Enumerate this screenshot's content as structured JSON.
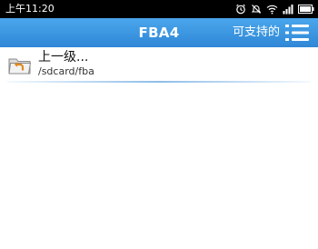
{
  "status_bar": {
    "time": "上午11:20",
    "icons": [
      "alarm-icon",
      "mute-icon",
      "wifi-icon",
      "signal-icon",
      "battery-icon"
    ]
  },
  "app_bar": {
    "title": "FBA4",
    "supported_label": "可支持的",
    "menu_icon": "hamburger-menu-icon",
    "colors": {
      "background": "#3d97e1",
      "text": "#ffffff"
    }
  },
  "list": {
    "items": [
      {
        "icon": "folder-up-icon",
        "title": "上一级...",
        "path": "/sdcard/fba"
      }
    ]
  }
}
